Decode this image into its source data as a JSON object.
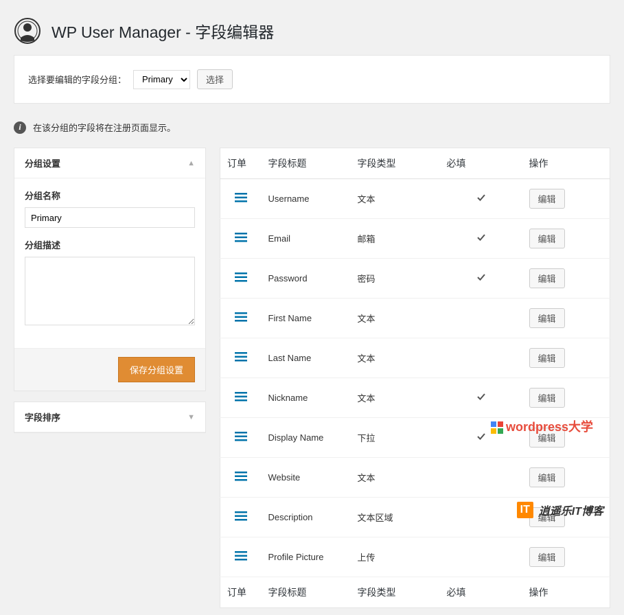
{
  "header": {
    "title": "WP User Manager - 字段编辑器"
  },
  "selector": {
    "label": "选择要编辑的字段分组：",
    "selected": "Primary",
    "button": "选择"
  },
  "info": {
    "text": "在该分组的字段将在注册页面显示。"
  },
  "sidebar": {
    "group_settings": {
      "title": "分组设置",
      "name_label": "分组名称",
      "name_value": "Primary",
      "desc_label": "分组描述",
      "desc_value": "",
      "save_button": "保存分组设置"
    },
    "field_order": {
      "title": "字段排序"
    }
  },
  "table": {
    "headers": {
      "order": "订单",
      "title": "字段标题",
      "type": "字段类型",
      "required": "必填",
      "action": "操作"
    },
    "edit_label": "编辑",
    "rows": [
      {
        "title": "Username",
        "type": "文本",
        "required": true
      },
      {
        "title": "Email",
        "type": "邮箱",
        "required": true
      },
      {
        "title": "Password",
        "type": "密码",
        "required": true
      },
      {
        "title": "First Name",
        "type": "文本",
        "required": false
      },
      {
        "title": "Last Name",
        "type": "文本",
        "required": false
      },
      {
        "title": "Nickname",
        "type": "文本",
        "required": true
      },
      {
        "title": "Display Name",
        "type": "下拉",
        "required": true
      },
      {
        "title": "Website",
        "type": "文本",
        "required": false
      },
      {
        "title": "Description",
        "type": "文本区域",
        "required": false
      },
      {
        "title": "Profile Picture",
        "type": "上传",
        "required": false
      }
    ]
  },
  "watermark": "wordpress大学",
  "footer_logo": "逍遥乐IT博客"
}
